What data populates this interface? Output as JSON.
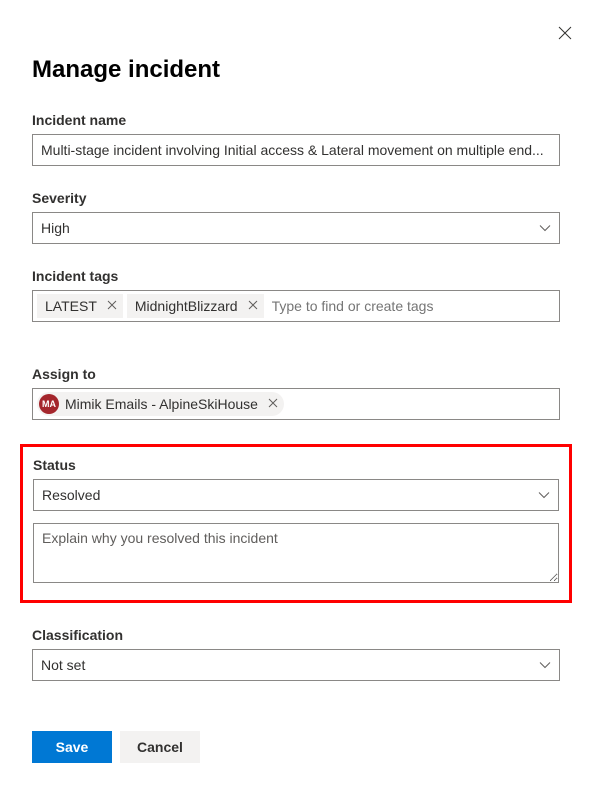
{
  "title": "Manage incident",
  "fields": {
    "incidentName": {
      "label": "Incident name",
      "value": "Multi-stage incident involving Initial access & Lateral movement on multiple end..."
    },
    "severity": {
      "label": "Severity",
      "value": "High"
    },
    "tags": {
      "label": "Incident tags",
      "items": [
        "LATEST",
        "MidnightBlizzard"
      ],
      "placeholder": "Type to find or create tags"
    },
    "assignTo": {
      "label": "Assign to",
      "assignee": {
        "initials": "MA",
        "name": "Mimik Emails - AlpineSkiHouse"
      }
    },
    "status": {
      "label": "Status",
      "value": "Resolved",
      "explanation": {
        "placeholder": "Explain why you resolved this incident",
        "value": ""
      }
    },
    "classification": {
      "label": "Classification",
      "value": "Not set"
    }
  },
  "buttons": {
    "save": "Save",
    "cancel": "Cancel"
  }
}
